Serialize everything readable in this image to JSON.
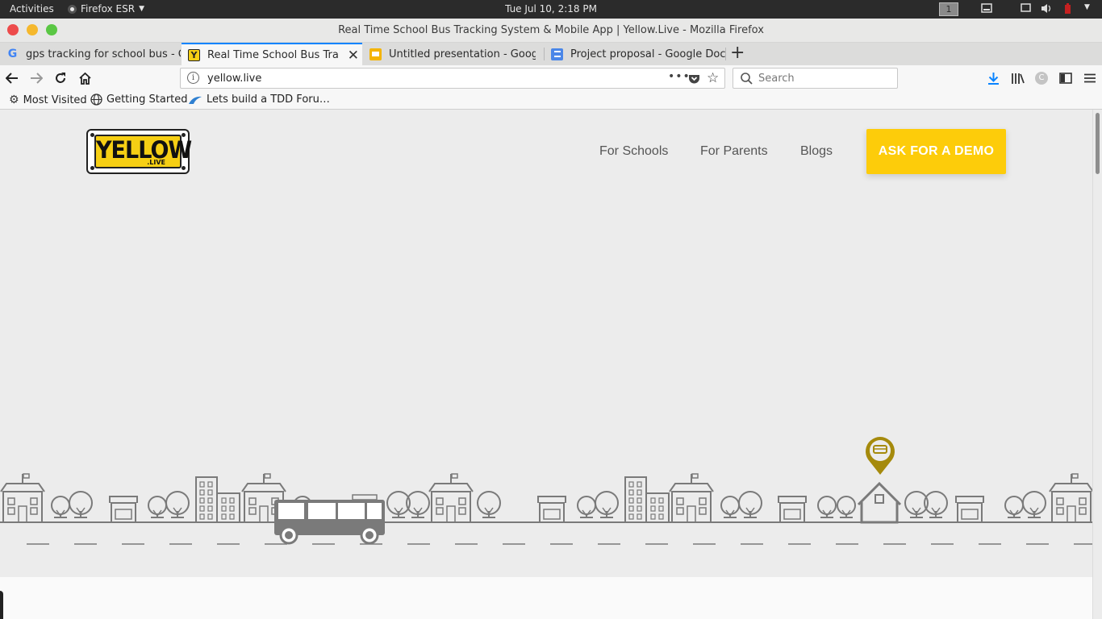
{
  "system_bar": {
    "activities": "Activities",
    "app_name": "Firefox ESR",
    "clock": "Tue Jul 10,  2:18 PM",
    "workspace": "1"
  },
  "window": {
    "title": "Real Time School Bus Tracking System & Mobile App | Yellow.Live - Mozilla Firefox"
  },
  "tabs": [
    {
      "label": "gps tracking for school bus - Google Search",
      "favicon": "google-icon"
    },
    {
      "label": "Real Time School Bus Tracking System & Mobile App",
      "favicon": "yellow-live-icon",
      "active": true
    },
    {
      "label": "Untitled presentation - Google Slides",
      "favicon": "slides-icon"
    },
    {
      "label": "Project proposal - Google Docs",
      "favicon": "docs-icon"
    }
  ],
  "navigation": {
    "url": "yellow.live",
    "search_placeholder": "Search"
  },
  "bookmarks": [
    {
      "label": "Most Visited",
      "icon": "gear-icon"
    },
    {
      "label": "Getting Started",
      "icon": "globe-icon"
    },
    {
      "label": "Lets build a TDD Foru…",
      "icon": "bookmark-site-icon"
    }
  ],
  "site": {
    "logo": {
      "word": "YELLOW",
      "sub": ".LIVE"
    },
    "nav": [
      "For Schools",
      "For Parents",
      "Blogs"
    ],
    "cta": "ASK FOR A DEMO",
    "colors": {
      "accent": "#fdcc0a",
      "pin": "#a58a0c",
      "illustration": "#7a7a7a",
      "page_bg": "#ececec"
    }
  }
}
